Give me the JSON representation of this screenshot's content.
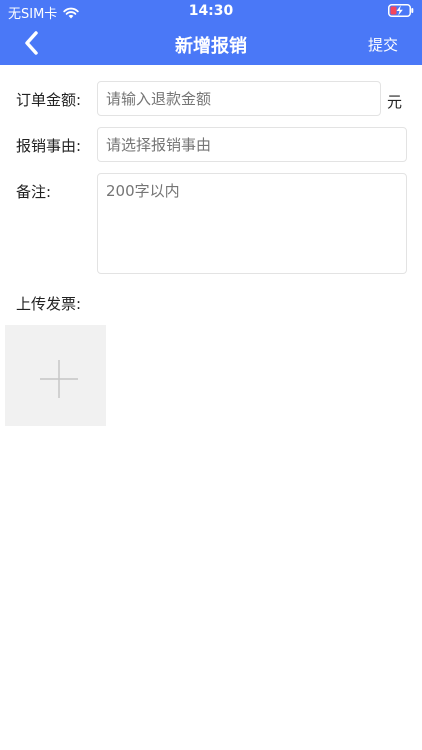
{
  "status_bar": {
    "carrier": "无SIM卡",
    "time": "14:30"
  },
  "nav": {
    "title": "新增报销",
    "submit_label": "提交",
    "back_icon": "chevron-left-icon"
  },
  "form": {
    "amount": {
      "label": "订单金额:",
      "placeholder": "请输入退款金额",
      "unit": "元"
    },
    "reason": {
      "label": "报销事由:",
      "placeholder": "请选择报销事由"
    },
    "remark": {
      "label": "备注:",
      "placeholder": "200字以内"
    },
    "invoice": {
      "label": "上传发票:"
    }
  },
  "colors": {
    "header": "#4a78f7",
    "placeholder": "#c4c4c4",
    "border": "#e3e3e3",
    "upload_bg": "#f1f1f1"
  }
}
